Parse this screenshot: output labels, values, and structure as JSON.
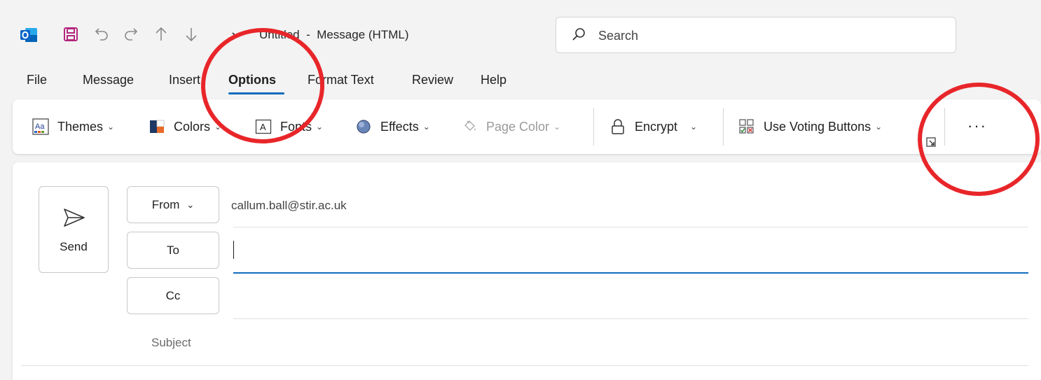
{
  "window": {
    "title": "Untitled  -  Message (HTML)"
  },
  "search": {
    "placeholder": "Search"
  },
  "quick_access_icons": [
    "save-icon",
    "undo-icon",
    "redo-icon",
    "up-arrow-icon",
    "down-arrow-icon",
    "customize-chevron-icon"
  ],
  "menu": {
    "tabs": [
      "File",
      "Message",
      "Insert",
      "Options",
      "Format Text",
      "Review",
      "Help"
    ],
    "active": "Options"
  },
  "ribbon": {
    "themes": "Themes",
    "colors": "Colors",
    "fonts": "Fonts",
    "effects": "Effects",
    "page_color": "Page Color",
    "encrypt": "Encrypt",
    "voting": "Use Voting Buttons",
    "more": "···"
  },
  "compose": {
    "send_label": "Send",
    "from_label": "From",
    "to_label": "To",
    "cc_label": "Cc",
    "subject_label": "Subject",
    "from_address": "callum.ball@stir.ac.uk",
    "to_value": "",
    "cc_value": "",
    "subject_value": ""
  },
  "colors": {
    "accent": "#0f6cbd",
    "annotation": "#e8262a",
    "outlook_blue": "#0a64c8",
    "save_purple": "#b4257c"
  }
}
